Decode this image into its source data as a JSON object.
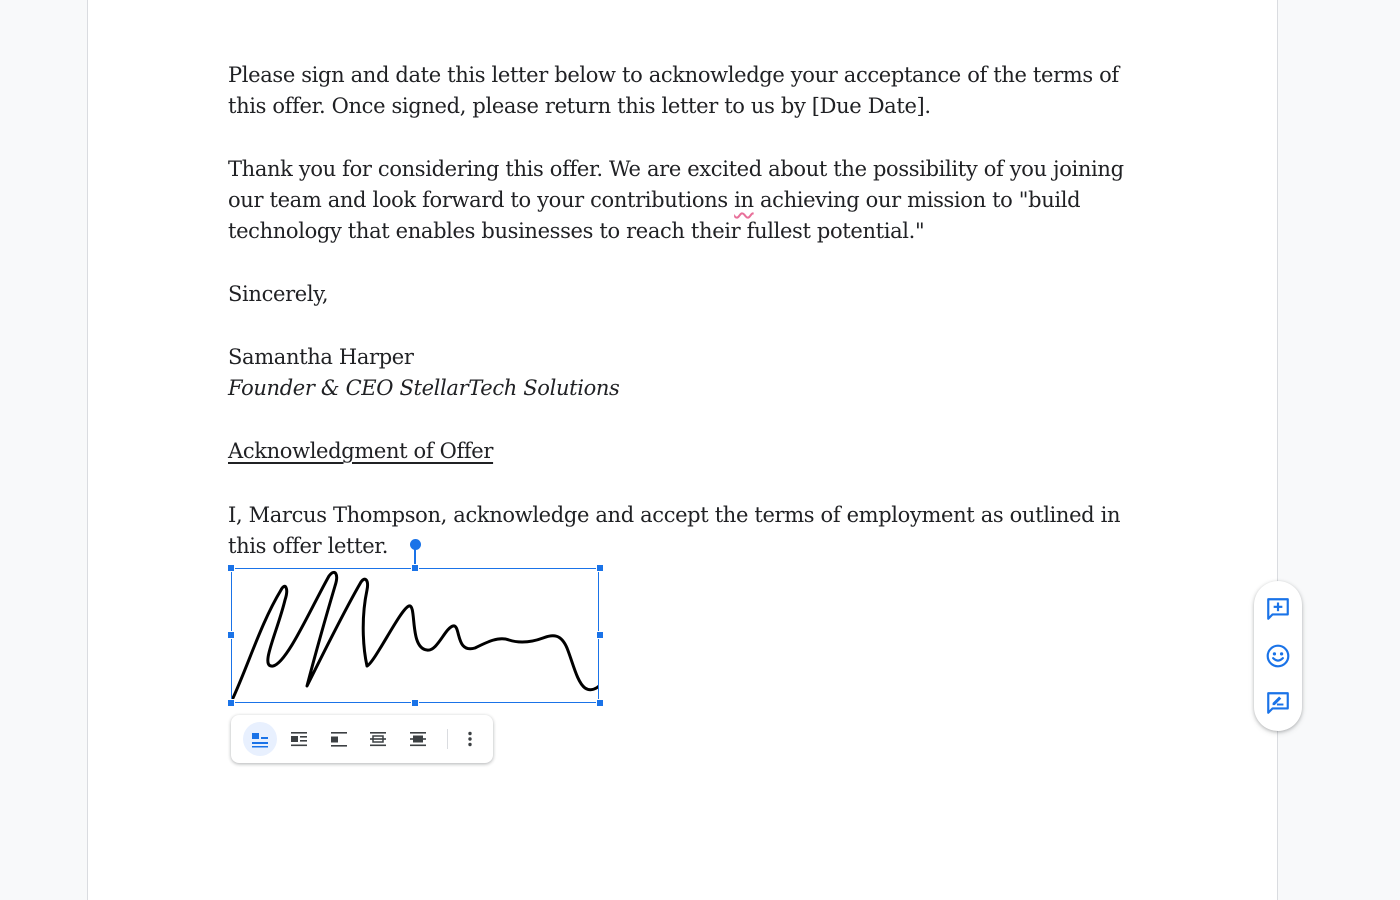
{
  "document": {
    "para1": "Please sign and date this letter below to acknowledge your acceptance of the terms of this offer. Once signed, please return this letter to us by [Due Date].",
    "para2_before": "Thank you for considering this offer. We are excited about the possibility of you joining our team and look forward to your contributions ",
    "para2_flagged_word": "in",
    "para2_after": " achieving our mission to \"build technology that enables businesses to reach their fullest potential.\"",
    "closing": "Sincerely,",
    "signer_name": "Samantha Harper",
    "signer_title": "Founder & CEO StellarTech Solutions",
    "ack_heading": "Acknowledgment of Offer",
    "ack_text": "I, Marcus Thompson, acknowledge and accept the terms of employment as outlined in this offer letter."
  },
  "image_toolbar": {
    "buttons": [
      "in-line-icon",
      "wrap-text-icon",
      "break-text-icon",
      "behind-text-icon",
      "in-front-of-text-icon",
      "more-options-icon"
    ],
    "active": "in-line-icon"
  },
  "side_panel": {
    "buttons": [
      "add-comment-icon",
      "add-emoji-reaction-icon",
      "suggest-edits-icon"
    ]
  },
  "colors": {
    "accent": "#1a73e8",
    "text": "#202124",
    "spellcheck": "#e8709a",
    "active_bg": "#e8f0fe"
  }
}
